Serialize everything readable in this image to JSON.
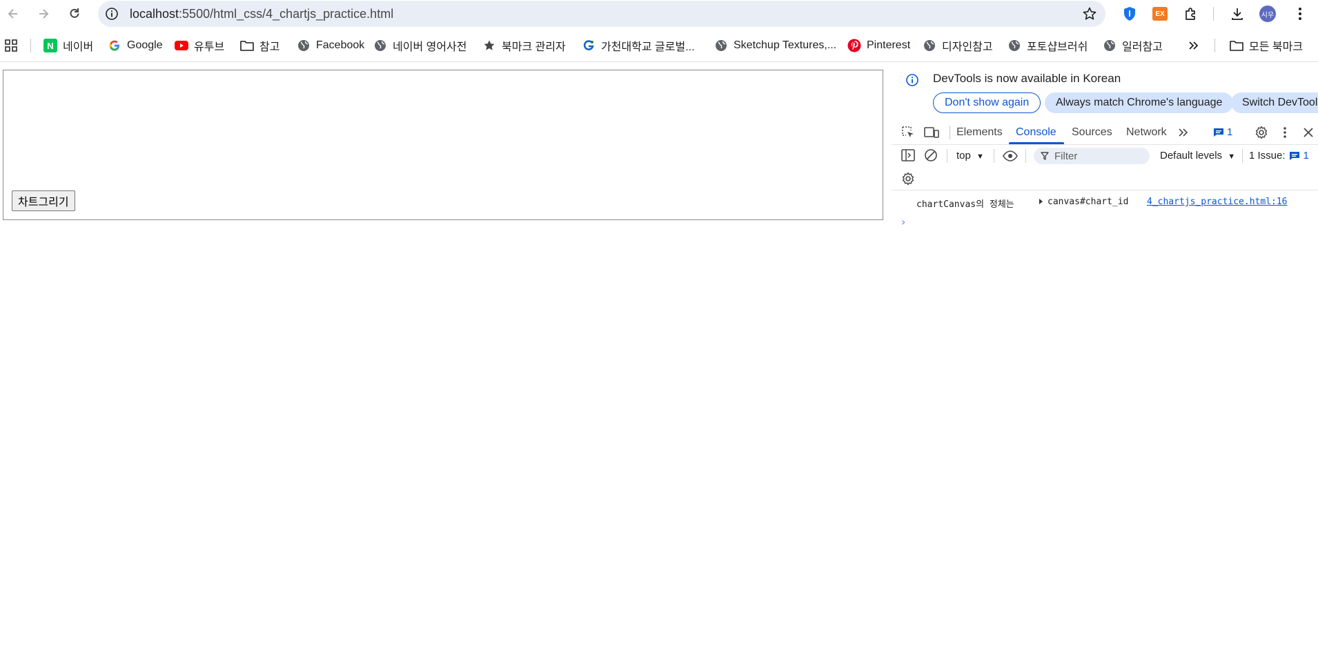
{
  "browser": {
    "url_host": "localhost",
    "url_path": ":5500/html_css/4_chartjs_practice.html",
    "profile_initials": "시우",
    "ext_ex_label": "EX"
  },
  "bookmarks": {
    "items": [
      {
        "label": "네이버",
        "icon": "naver-icon"
      },
      {
        "label": "Google",
        "icon": "google-icon"
      },
      {
        "label": "유투브",
        "icon": "youtube-icon"
      },
      {
        "label": "참고",
        "icon": "folder-icon"
      },
      {
        "label": "Facebook",
        "icon": "globe-icon"
      },
      {
        "label": "네이버 영어사전",
        "icon": "globe-icon"
      },
      {
        "label": "북마크 관리자",
        "icon": "star-icon"
      },
      {
        "label": "가천대학교 글로벌...",
        "icon": "gachon-icon"
      },
      {
        "label": "Sketchup Textures,...",
        "icon": "globe-icon"
      },
      {
        "label": "Pinterest",
        "icon": "pinterest-icon"
      },
      {
        "label": "디자인참고",
        "icon": "globe-icon"
      },
      {
        "label": "포토샵브러쉬",
        "icon": "globe-icon"
      },
      {
        "label": "일러참고",
        "icon": "globe-icon"
      }
    ],
    "all_bookmarks": "모든 북마크"
  },
  "page": {
    "draw_button": "차트그리기"
  },
  "devtools": {
    "notice": "DevTools is now available in Korean",
    "dont_show": "Don't show again",
    "match_language": "Always match Chrome's language",
    "switch": "Switch DevTools",
    "tabs": [
      "Elements",
      "Console",
      "Sources",
      "Network"
    ],
    "active_tab": "Console",
    "issues_count": "1",
    "context": "top",
    "filter_placeholder": "Filter",
    "levels": "Default levels",
    "issue_label": "1 Issue:",
    "issue_count2": "1",
    "log": {
      "message": "chartCanvas의 정체는",
      "object": "canvas#chart_id",
      "source": "4_chartjs_practice.html:16"
    }
  },
  "colors": {
    "accent": "#0b57d0",
    "omnibox_bg": "#e9eef6",
    "pill_bg": "#d3e3fd"
  }
}
